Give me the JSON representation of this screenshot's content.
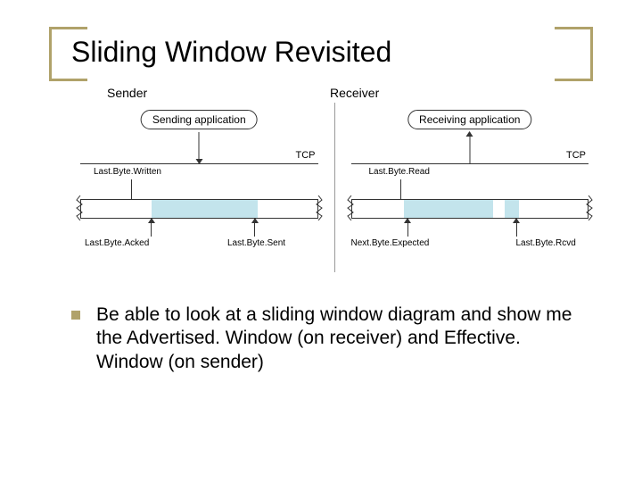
{
  "title": "Sliding Window Revisited",
  "columns": {
    "sender": "Sender",
    "receiver": "Receiver"
  },
  "sender": {
    "app": "Sending application",
    "tcp": "TCP",
    "topLabel": "Last.Byte.Written",
    "bottomLeft": "Last.Byte.Acked",
    "bottomRight": "Last.Byte.Sent"
  },
  "receiver": {
    "app": "Receiving application",
    "tcp": "TCP",
    "topLabel": "Last.Byte.Read",
    "bottomLeft": "Next.Byte.Expected",
    "bottomRight": "Last.Byte.Rcvd"
  },
  "bullet": "Be able to look at a sliding window diagram and show me the Advertised. Window (on receiver) and Effective. Window (on sender)"
}
